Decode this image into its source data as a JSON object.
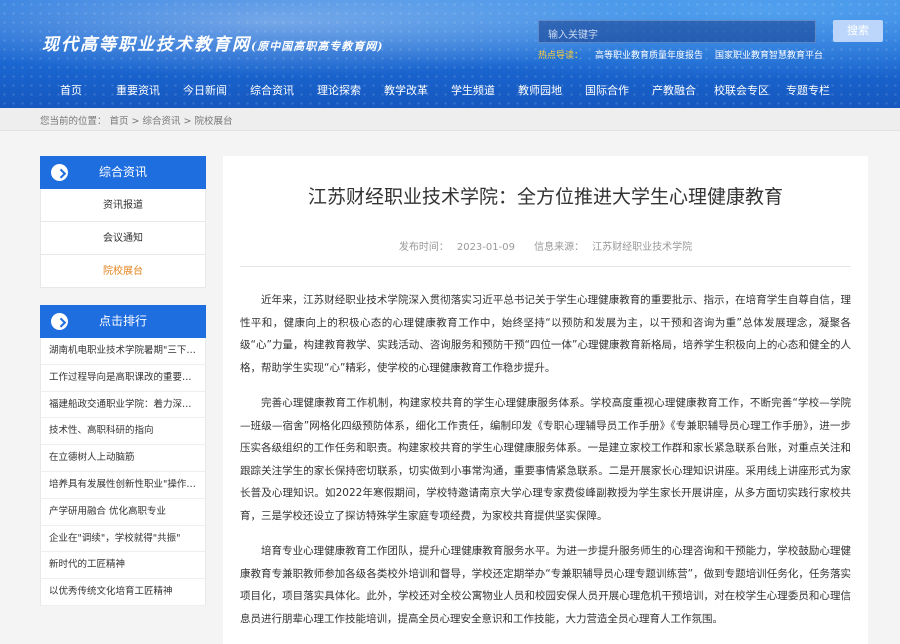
{
  "header": {
    "logo_title": "现代高等职业技术教育网",
    "logo_sub": "(原中国高职高专教育网)",
    "search_placeholder": "输入关键字",
    "search_button": "搜索",
    "hot_label": "热点导读：",
    "hot_links": [
      "高等职业教育质量年度报告",
      "国家职业教育智慧教育平台"
    ]
  },
  "nav": [
    "首页",
    "重要资讯",
    "今日新闻",
    "综合资讯",
    "理论探索",
    "教学改革",
    "学生频道",
    "教师园地",
    "国际合作",
    "产教融合",
    "校联会专区",
    "专题专栏"
  ],
  "breadcrumb": "您当前的位置： 首页 > 综合资讯 > 院校展台",
  "sidebar": {
    "section_title": "综合资讯",
    "items": [
      {
        "label": "资讯报道",
        "active": false
      },
      {
        "label": "会议通知",
        "active": false
      },
      {
        "label": "院校展台",
        "active": true
      }
    ],
    "rank_title": "点击排行",
    "rank_items": [
      "湖南机电职业技术学院暑期\"三下…",
      "工作过程导向是高职课改的重要…",
      "福建船政交通职业学院：着力深…",
      "技术性、高职科研的指向",
      "在立德树人上动脑筋",
      "培养具有发展性创新性职业\"操作…",
      "产学研用融合 优化高职专业",
      "企业在\"调续\"，学校就得\"共振\"",
      "新时代的工匠精神",
      "以优秀传统文化培育工匠精神"
    ]
  },
  "article": {
    "title": "江苏财经职业技术学院：全方位推进大学生心理健康教育",
    "publish_label": "发布时间：",
    "publish_date": "2023-01-09",
    "source_label": "信息来源：",
    "source": "江苏财经职业技术学院",
    "paragraphs": [
      "近年来，江苏财经职业技术学院深入贯彻落实习近平总书记关于学生心理健康教育的重要批示、指示，在培育学生自尊自信，理性平和，健康向上的积极心态的心理健康教育工作中，始终坚持“以预防和发展为主，以干预和咨询为重”总体发展理念，凝聚各级“心”力量，构建教育教学、实践活动、咨询服务和预防干预“四位一体”心理健康教育新格局，培养学生积极向上的心态和健全的人格，帮助学生实现“心”精彩，使学校的心理健康教育工作稳步提升。",
      "完善心理健康教育工作机制，构建家校共育的学生心理健康服务体系。学校高度重视心理健康教育工作，不断完善“学校—学院—班级—宿舍”网格化四级预防体系，细化工作责任，编制印发《专职心理辅导员工作手册》《专兼职辅导员心理工作手册》，进一步压实各级组织的工作任务和职责。构建家校共育的学生心理健康服务体系。一是建立家校工作群和家长紧急联系台账，对重点关注和跟踪关注学生的家长保持密切联系，切实做到小事常沟通，重要事情紧急联系。二是开展家长心理知识讲座。采用线上讲座形式为家长普及心理知识。如2022年寒假期间，学校特邀请南京大学心理专家费俊峰副教授为学生家长开展讲座，从多方面切实践行家校共育，三是学校还设立了探访特殊学生家庭专项经费，为家校共育提供坚实保障。",
      "培育专业心理健康教育工作团队，提升心理健康教育服务水平。为进一步提升服务师生的心理咨询和干预能力，学校鼓励心理健康教育专兼职教师参加各级各类校外培训和督导，学校还定期举办“专兼职辅导员心理专题训练营”，做到专题培训任务化，任务落实项目化，项目落实具体化。此外，学校还对全校公寓物业人员和校园安保人员开展心理危机干预培训，对在校学生心理委员和心理信息员进行朋辈心理工作技能培训，提高全员心理安全意识和工作技能，大力营造全员心理育人工作氛围。"
    ]
  }
}
